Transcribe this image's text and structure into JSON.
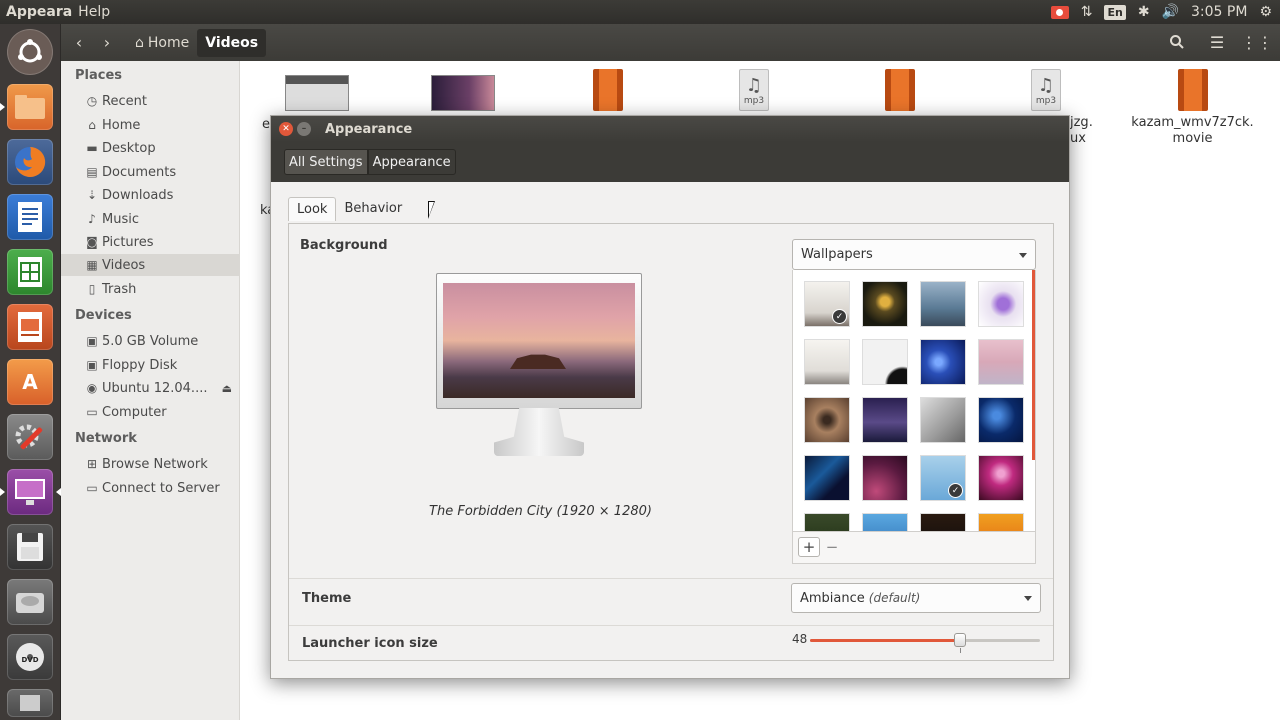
{
  "top_panel": {
    "app_menu": [
      "Appeara",
      "Help"
    ],
    "keyboard_layout": "En",
    "clock": "3:05 PM"
  },
  "nautilus": {
    "breadcrumb": [
      "Home",
      "Videos"
    ],
    "sidebar": {
      "places_title": "Places",
      "places": [
        {
          "label": "Recent",
          "icon": "clock-icon"
        },
        {
          "label": "Home",
          "icon": "home-icon"
        },
        {
          "label": "Desktop",
          "icon": "folder-icon"
        },
        {
          "label": "Documents",
          "icon": "document-icon"
        },
        {
          "label": "Downloads",
          "icon": "download-icon"
        },
        {
          "label": "Music",
          "icon": "music-icon"
        },
        {
          "label": "Pictures",
          "icon": "camera-icon"
        },
        {
          "label": "Videos",
          "icon": "film-icon"
        },
        {
          "label": "Trash",
          "icon": "trash-icon"
        }
      ],
      "devices_title": "Devices",
      "devices": [
        {
          "label": "5.0 GB Volume",
          "icon": "drive-icon"
        },
        {
          "label": "Floppy Disk",
          "icon": "drive-icon"
        },
        {
          "label": "Ubuntu 12.04....",
          "icon": "disc-icon"
        },
        {
          "label": "Computer",
          "icon": "computer-icon"
        }
      ],
      "network_title": "Network",
      "network": [
        {
          "label": "Browse Network",
          "icon": "network-icon"
        },
        {
          "label": "Connect to Server",
          "icon": "server-icon"
        }
      ]
    },
    "files": {
      "partial_labels": [
        "e",
        "ka",
        "jzg.",
        "ux"
      ],
      "last_file": [
        "kazam_wmv7z7ck.",
        "movie"
      ],
      "mp3_tag": "mp3"
    }
  },
  "dialog": {
    "title": "Appearance",
    "toolbar": [
      "All Settings",
      "Appearance"
    ],
    "tabs": [
      "Look",
      "Behavior"
    ],
    "background_label": "Background",
    "wallpaper_caption": "The Forbidden City (1920 × 1280)",
    "source_combo": "Wallpapers",
    "theme_label": "Theme",
    "theme_value": "Ambiance",
    "theme_note": "(default)",
    "launcher_label": "Launcher icon size",
    "launcher_size": "48",
    "launcher_fraction": 0.65,
    "add_symbol": "+",
    "remove_symbol": "−"
  },
  "colors": {
    "accent": "#e1583a",
    "panel": "#3c3b37"
  }
}
